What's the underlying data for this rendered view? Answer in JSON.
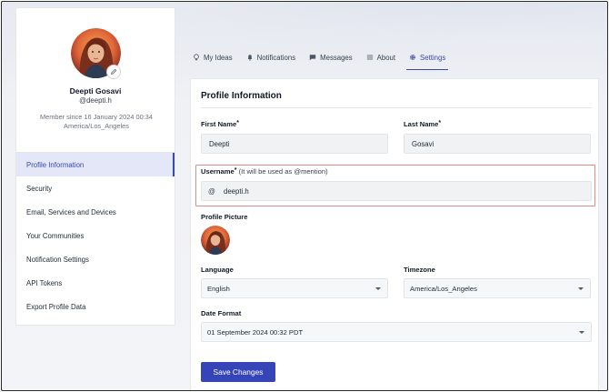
{
  "profile": {
    "name": "Deepti Gosavi",
    "handle": "@deepti.h",
    "member_since_line1": "Member since 16 January 2024 00:34",
    "member_since_line2": "America/Los_Angeles"
  },
  "sidebar": {
    "items": [
      {
        "label": "Profile Information",
        "active": true
      },
      {
        "label": "Security"
      },
      {
        "label": "Email, Services and Devices"
      },
      {
        "label": "Your Communities"
      },
      {
        "label": "Notification Settings"
      },
      {
        "label": "API Tokens"
      },
      {
        "label": "Export Profile Data"
      }
    ]
  },
  "tabs": [
    {
      "label": "My Ideas",
      "icon": "lightbulb-icon"
    },
    {
      "label": "Notifications",
      "icon": "bell-icon"
    },
    {
      "label": "Messages",
      "icon": "chat-icon"
    },
    {
      "label": "About",
      "icon": "list-icon"
    },
    {
      "label": "Settings",
      "icon": "gear-icon",
      "active": true
    }
  ],
  "form": {
    "title": "Profile Information",
    "first_name": {
      "label": "First Name",
      "required": "*",
      "value": "Deepti"
    },
    "last_name": {
      "label": "Last Name",
      "required": "*",
      "value": "Gosavi"
    },
    "username": {
      "label": "Username",
      "required": "*",
      "hint": "(It will be used as @mention)",
      "prefix": "@",
      "value": "deepti.h"
    },
    "profile_picture": {
      "label": "Profile Picture"
    },
    "language": {
      "label": "Language",
      "value": "English"
    },
    "timezone": {
      "label": "Timezone",
      "value": "America/Los_Angeles"
    },
    "date_format": {
      "label": "Date Format",
      "value": "01 September 2024 00:32 PDT"
    },
    "save_label": "Save Changes"
  },
  "colors": {
    "accent": "#3545b8",
    "active_nav_bg": "#e4e7f7",
    "highlight_border": "#e58a86"
  }
}
